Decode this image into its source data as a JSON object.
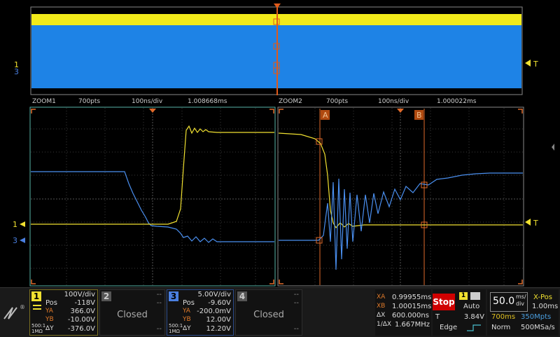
{
  "overview": {
    "marker": "T"
  },
  "zoom1": {
    "name": "ZOOM1",
    "pts": "700pts",
    "timebase": "100ns/div",
    "offset": "1.008668ms"
  },
  "zoom2": {
    "name": "ZOOM2",
    "pts": "700pts",
    "timebase": "100ns/div",
    "offset": "1.000022ms"
  },
  "cursors_labels": {
    "a": "A",
    "b": "B"
  },
  "channel_markers": {
    "ch1": "1",
    "ch3": "3",
    "trigger": "T"
  },
  "ch1": {
    "num": "1",
    "scale": "100V/div",
    "pos_label": "Pos",
    "pos": "-118V",
    "ya_label": "YA",
    "ya": "366.0V",
    "yb_label": "YB",
    "yb": "-10.00V",
    "dy_label": "ΔY",
    "dy": "-376.0V",
    "coupling": "500:1",
    "impedance": "1MΩ",
    "color": "#f0e030"
  },
  "ch2": {
    "num": "2",
    "top1": "--",
    "top2": "--",
    "status": "Closed",
    "bot": "--"
  },
  "ch3": {
    "num": "3",
    "scale": "5.00V/div",
    "pos_label": "Pos",
    "pos": "-9.60V",
    "ya_label": "YA",
    "ya": "-200.0mV",
    "yb_label": "YB",
    "yb": "12.00V",
    "dy_label": "ΔY",
    "dy": "12.20V",
    "coupling": "500:1",
    "impedance": "1MΩ",
    "color": "#4a7fe0"
  },
  "ch4": {
    "num": "4",
    "top1": "--",
    "top2": "--",
    "status": "Closed",
    "bot": "--"
  },
  "cursors": {
    "xa_label": "XA",
    "xa": "0.99955ms",
    "xb_label": "XB",
    "xb": "1.00015ms",
    "dx_label": "ΔX",
    "dx": "600.000ns",
    "inv_label": "1/ΔX",
    "inv": "1.667MHz"
  },
  "trigger": {
    "run_state": "Stop",
    "source": "1",
    "mode": "Auto",
    "level_label": "T",
    "level": "3.84V",
    "type": "Edge"
  },
  "timebase": {
    "value": "50.0",
    "unit_top": "ms/",
    "unit_bot": "div",
    "xpos_label": "X-Pos",
    "xpos": "1.00ms",
    "mem": "700ms",
    "pts": "350Mpts",
    "acq": "Norm",
    "rate": "500MSa/s"
  },
  "colors": {
    "ch1": "#f0e030",
    "ch3": "#4a7fe0",
    "cursor": "#e06a2a",
    "grid": "#444444",
    "frame": "#58b4a8"
  }
}
